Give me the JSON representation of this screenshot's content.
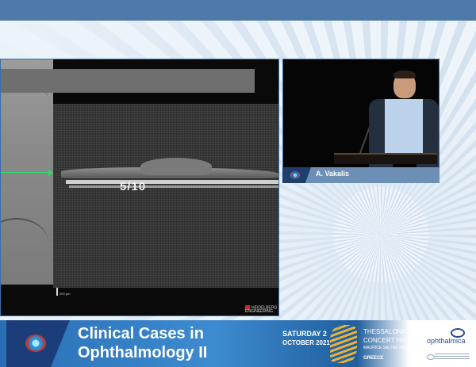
{
  "slide": {
    "scan_label": "5/10",
    "scale_label": "200 µm",
    "vendor_line1": "HEIDELBERG",
    "vendor_line2": "ENGINEERING"
  },
  "speaker": {
    "name": "A. Vakalis"
  },
  "banner": {
    "title_line1": "Clinical Cases in",
    "title_line2": "Ophthalmology II",
    "date_line1": "SATURDAY 2",
    "date_line2": "OCTOBER 2021",
    "venue_line1": "THESSALONIKI",
    "venue_line2": "CONCERT HALL",
    "venue_line3": "MAURICE SALTIEL HALL",
    "venue_line4": "GREECE",
    "organizer": "ophthalmica"
  },
  "colors": {
    "top_bar": "#4f79a8",
    "banner_blue": "#2a6fb5",
    "name_bar": "#6d8fb5",
    "scan_line": "#2fd86a"
  }
}
